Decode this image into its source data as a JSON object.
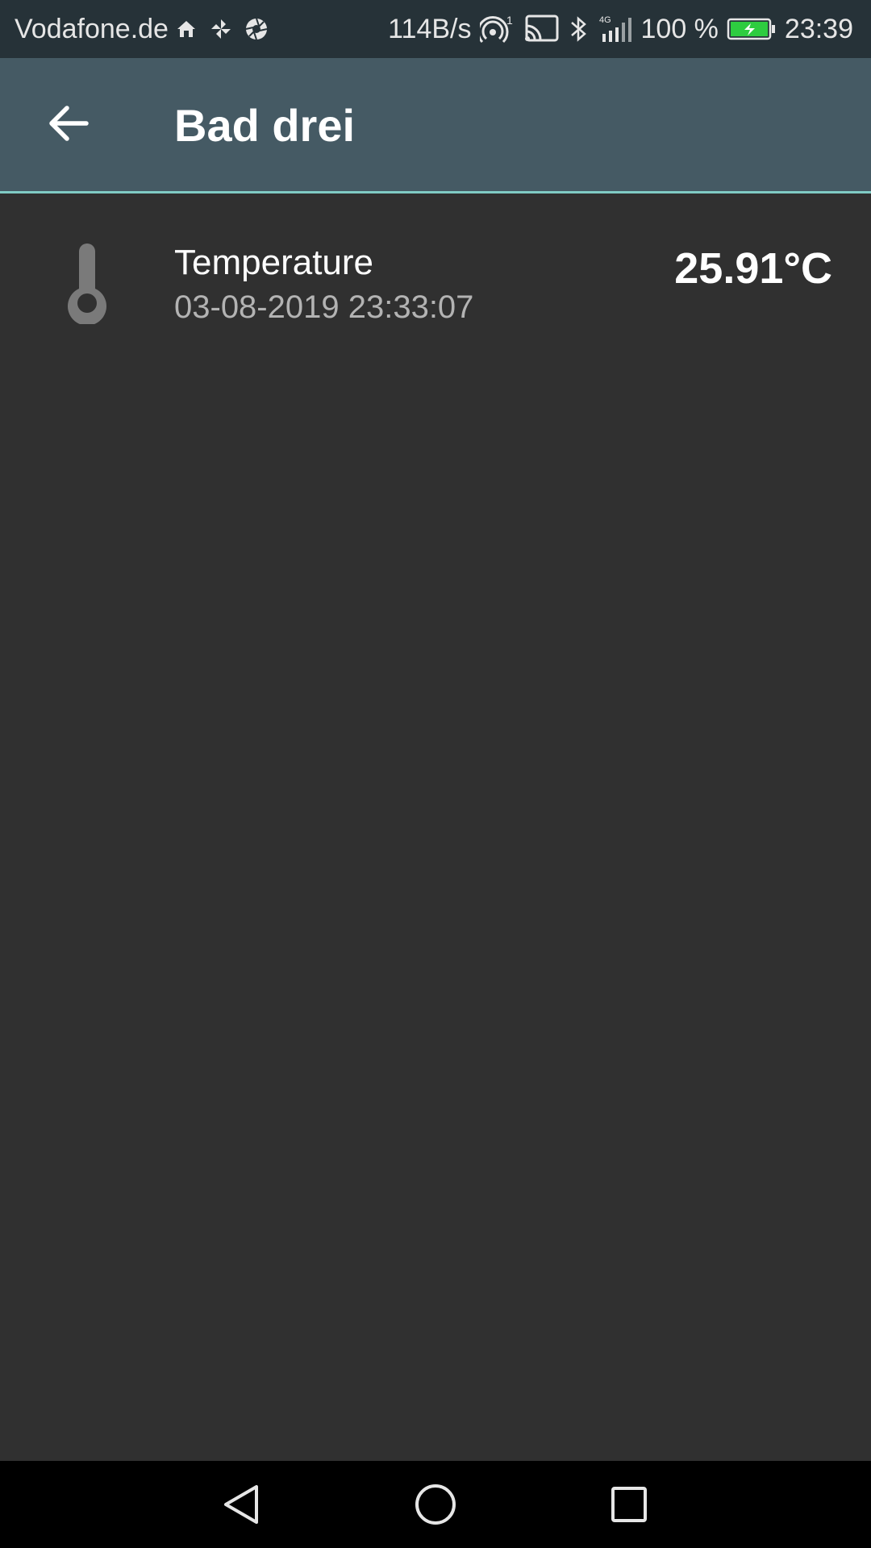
{
  "status_bar": {
    "carrier": "Vodafone.de",
    "net_speed": "114B/s",
    "hotspot_count": "1",
    "network_type": "4G",
    "battery_percent": "100 %",
    "time": "23:39",
    "icons": [
      "home-icon",
      "pinwheel-icon",
      "aperture-icon",
      "hotspot-icon",
      "cast-icon",
      "bluetooth-icon",
      "signal-icon",
      "battery-charging-icon"
    ],
    "battery_color": "#2ecc40"
  },
  "app_bar": {
    "title": "Bad drei",
    "back_icon": "arrow-back-icon",
    "background": "#455a64",
    "accent": "#80cbc4"
  },
  "sensors": [
    {
      "icon": "thermometer-icon",
      "name": "Temperature",
      "timestamp": "03-08-2019 23:33:07",
      "value": "25.91°C"
    }
  ],
  "nav_bar": {
    "buttons": [
      "back-triangle-icon",
      "home-circle-icon",
      "recents-square-icon"
    ]
  }
}
